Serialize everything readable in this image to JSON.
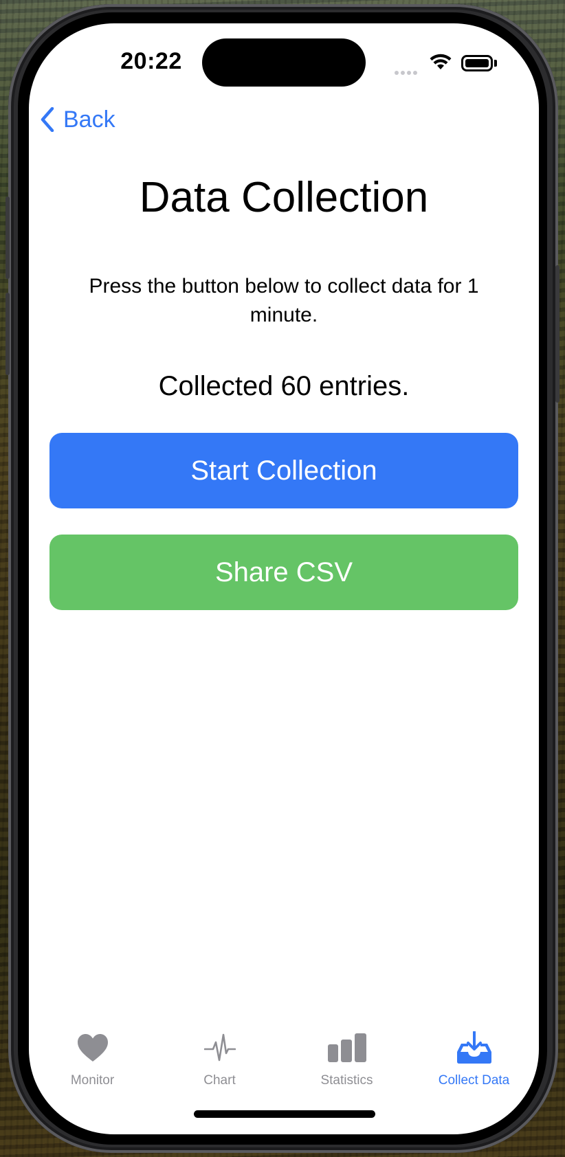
{
  "status_bar": {
    "time": "20:22"
  },
  "nav": {
    "back_label": "Back"
  },
  "page": {
    "title": "Data Collection",
    "description": "Press the button below to collect data for 1 minute.",
    "status": "Collected 60 entries."
  },
  "buttons": {
    "start_label": "Start Collection",
    "share_label": "Share CSV"
  },
  "tabs": [
    {
      "label": "Monitor",
      "icon": "heart-icon",
      "active": false
    },
    {
      "label": "Chart",
      "icon": "waveform-icon",
      "active": false
    },
    {
      "label": "Statistics",
      "icon": "bar-chart-icon",
      "active": false
    },
    {
      "label": "Collect Data",
      "icon": "tray-download-icon",
      "active": true
    }
  ],
  "colors": {
    "accent": "#3478f6",
    "start_button": "#3478f6",
    "share_button": "#65c466",
    "inactive_tab": "#8e8e93"
  }
}
